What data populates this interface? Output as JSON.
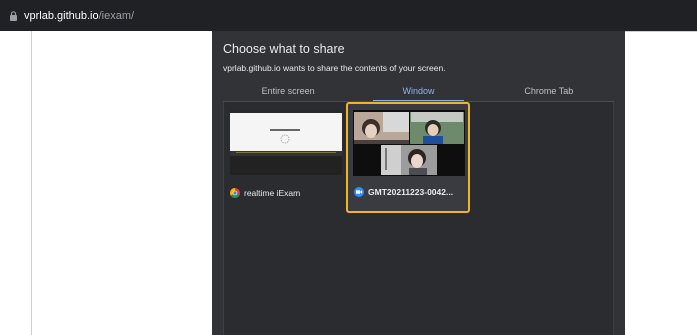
{
  "address_bar": {
    "host": "vprlab.github.io",
    "path": "/iexam/"
  },
  "dialog": {
    "title": "Choose what to share",
    "description": "vprlab.github.io wants to share the contents of your screen.",
    "tabs": [
      {
        "label": "Entire screen",
        "active": false
      },
      {
        "label": "Window",
        "active": true
      },
      {
        "label": "Chrome Tab",
        "active": false
      }
    ],
    "windows": [
      {
        "label": "realtime iExam",
        "icon": "chrome-icon",
        "selected": false
      },
      {
        "label": "GMT20211223-0042...",
        "icon": "video-app-icon",
        "selected": true
      }
    ]
  },
  "colors": {
    "selected_border": "#f0b429",
    "active_tab": "#8ab4f8",
    "dialog_bg": "#323337"
  }
}
